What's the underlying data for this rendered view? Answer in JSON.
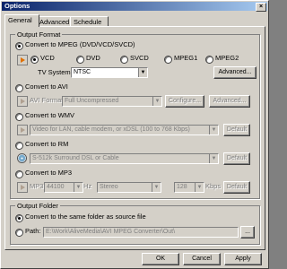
{
  "window": {
    "title": "Options"
  },
  "tabs": [
    "General",
    "Advanced",
    "Schedule"
  ],
  "output_format": {
    "label": "Output Format",
    "mpeg": {
      "label": "Convert to MPEG (DVD/VCD/SVCD)",
      "selected": true,
      "types": [
        "VCD",
        "DVD",
        "SVCD",
        "MPEG1",
        "MPEG2"
      ],
      "selected_type": "VCD",
      "tv_label": "TV System:",
      "tv_value": "NTSC",
      "advanced": "Advanced..."
    },
    "avi": {
      "label": "Convert to AVI",
      "format_label": "AVI Format:",
      "format_value": "Full Uncompressed",
      "configure": "Configure...",
      "advanced": "Advanced..."
    },
    "wmv": {
      "label": "Convert to WMV",
      "value": "Video for LAN, cable modem, or xDSL (100 to 768 Kbps)",
      "default": "Default"
    },
    "rm": {
      "label": "Convert to RM",
      "value": "S-512k Surround DSL or Cable",
      "default": "Default"
    },
    "mp3": {
      "label": "Convert to MP3",
      "rate": "44100",
      "hz": "Hz",
      "mode": "Stereo",
      "kbps_value": "128",
      "kbps": "Kbps",
      "default": "Default"
    }
  },
  "output_folder": {
    "label": "Output Folder",
    "same": "Convert to the same folder as source file",
    "path_label": "Path:",
    "path_value": "E:\\Work\\AliveMedia\\AVI MPEG Converter\\Out\\",
    "browse": "..."
  },
  "buttons": {
    "ok": "OK",
    "cancel": "Cancel",
    "apply": "Apply"
  }
}
